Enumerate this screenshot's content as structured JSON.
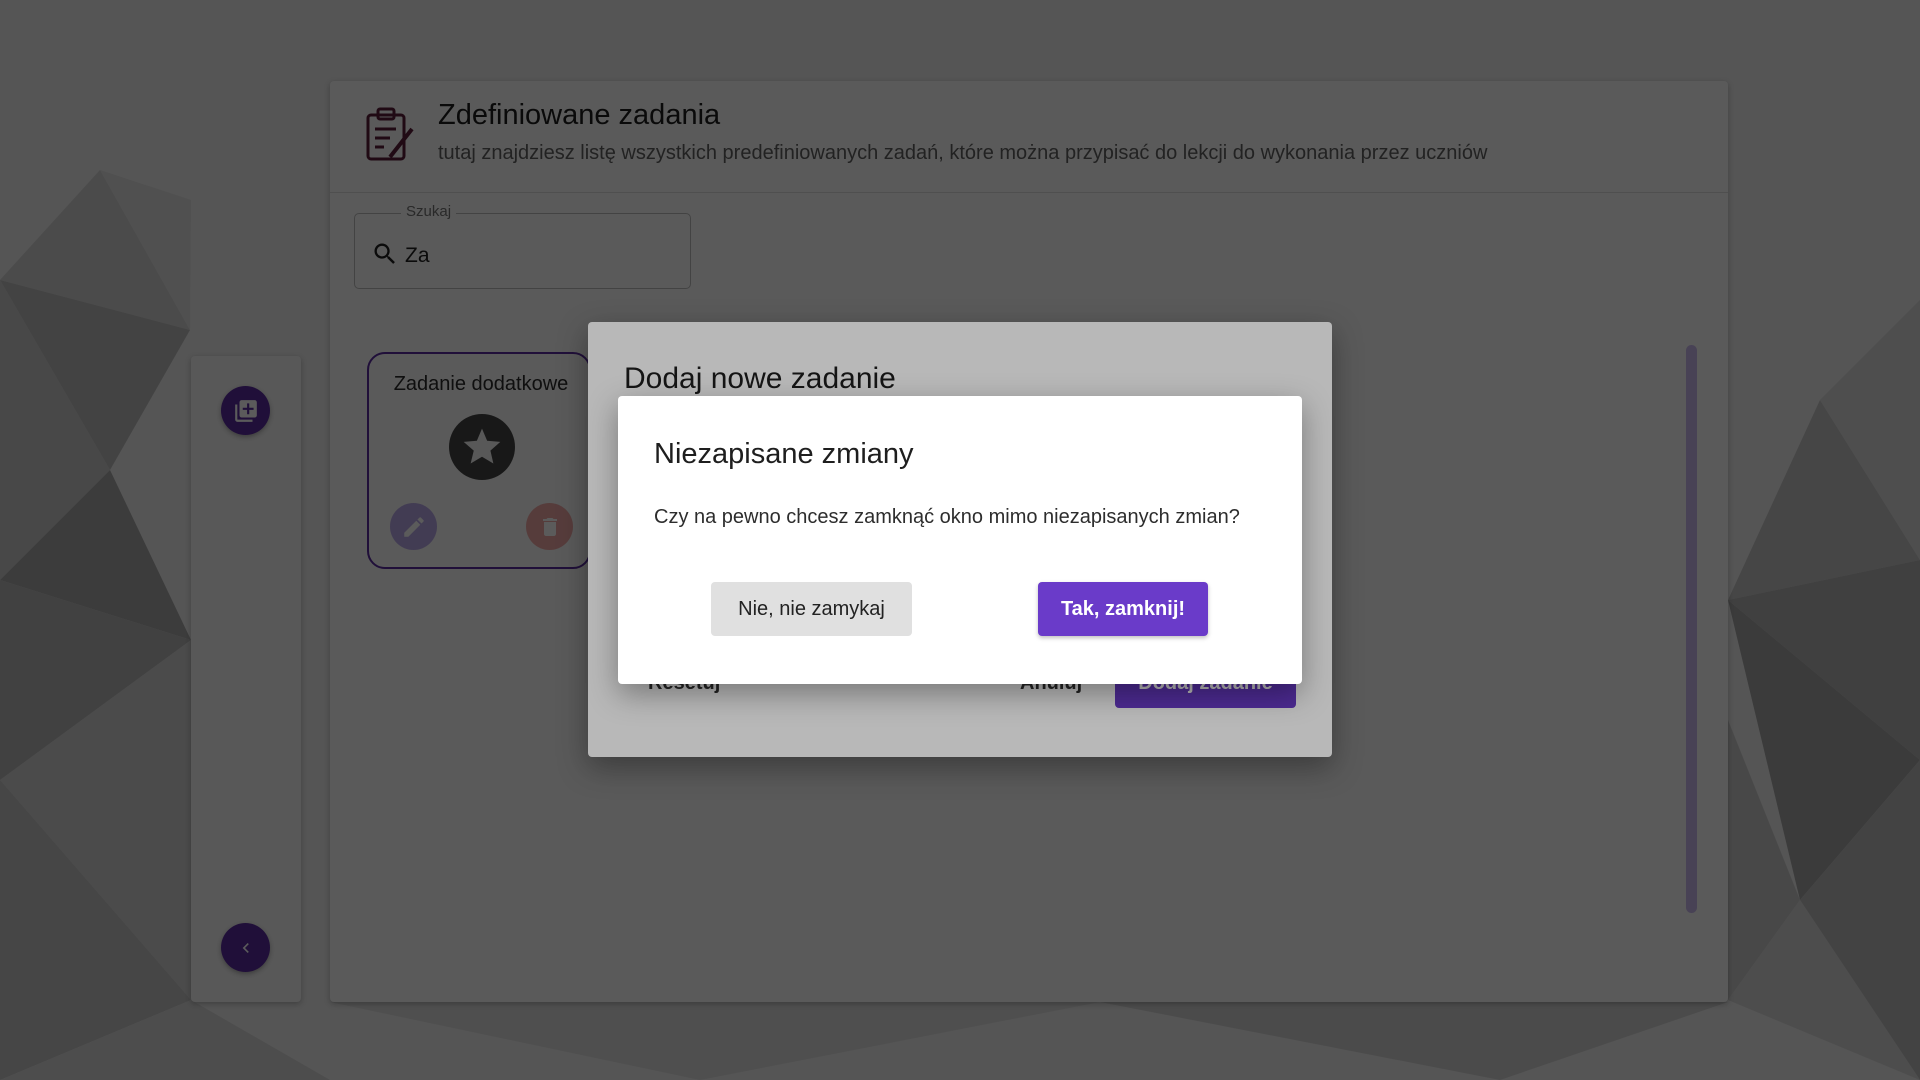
{
  "colors": {
    "accent": "#5a2ca0",
    "accent_button": "#6a3bc9",
    "edit_light": "#b9a8e6",
    "delete_light": "#f1a9a6",
    "icon_dark": "#5b1f3a"
  },
  "header": {
    "title": "Zdefiniowane zadania",
    "subtitle": "tutaj znajdziesz listę wszystkich predefiniowanych zadań, które można przypisać do lekcji do wykonania przez uczniów",
    "icon": "clipboard-edit-icon"
  },
  "search": {
    "label": "Szukaj",
    "value": "Za",
    "icon": "search-icon"
  },
  "sidebar": {
    "add_icon": "add-library-icon",
    "back_icon": "chevron-left-icon"
  },
  "tasks": [
    {
      "title": "Zadanie dodatkowe",
      "icon": "star-icon",
      "edit_icon": "pencil-icon",
      "delete_icon": "trash-icon"
    }
  ],
  "add_dialog": {
    "title": "Dodaj nowe zadanie",
    "reset_label": "Resetuj",
    "cancel_label": "Anuluj",
    "add_label": "Dodaj zadanie"
  },
  "confirm_dialog": {
    "title": "Niezapisane zmiany",
    "message": "Czy na pewno chcesz zamknąć okno mimo niezapisanych zmian?",
    "no_label": "Nie, nie zamykaj",
    "yes_label": "Tak, zamknij!"
  }
}
